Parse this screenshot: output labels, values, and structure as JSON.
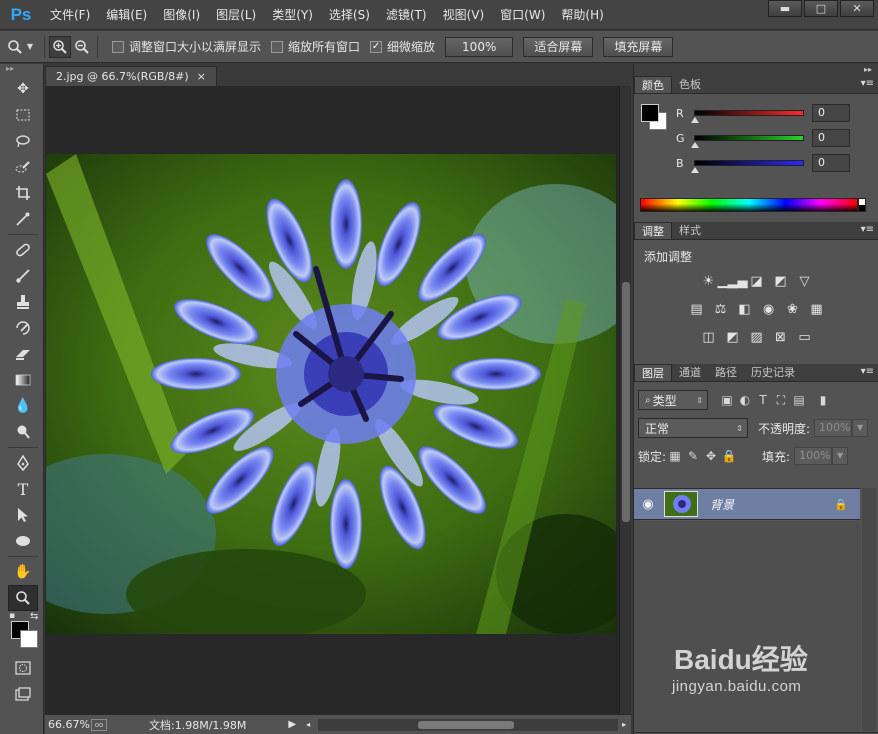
{
  "app": {
    "logo": "Ps"
  },
  "menu": [
    "文件(F)",
    "编辑(E)",
    "图像(I)",
    "图层(L)",
    "类型(Y)",
    "选择(S)",
    "滤镜(T)",
    "视图(V)",
    "窗口(W)",
    "帮助(H)"
  ],
  "window_controls": {
    "minimize": "▬",
    "maximize": "□",
    "close": "✕"
  },
  "options": {
    "resize_windows_label": "调整窗口大小以满屏显示",
    "resize_windows_checked": false,
    "zoom_all_windows_label": "缩放所有窗口",
    "zoom_all_windows_checked": false,
    "scrubby_zoom_label": "细微缩放",
    "scrubby_zoom_checked": true,
    "actual_pixels_label": "100%",
    "fit_screen_label": "适合屏幕",
    "fill_screen_label": "填充屏幕"
  },
  "document": {
    "tab_title": "2.jpg @ 66.7%(RGB/8#)",
    "tab_close": "×",
    "zoom": "66.67%",
    "doc_info": "文档:1.98M/1.98M"
  },
  "color_panel": {
    "tabs": [
      "颜色",
      "色板"
    ],
    "channels": [
      {
        "label": "R",
        "value": "0",
        "color": "#ff2a2a"
      },
      {
        "label": "G",
        "value": "0",
        "color": "#2ad42a"
      },
      {
        "label": "B",
        "value": "0",
        "color": "#2a2aff"
      }
    ],
    "foreground": "#000000",
    "background": "#ffffff"
  },
  "adjustments_panel": {
    "tabs": [
      "调整",
      "样式"
    ],
    "title": "添加调整"
  },
  "layers_panel": {
    "tabs": [
      "图层",
      "通道",
      "路径",
      "历史记录"
    ],
    "filter_kind": "类型",
    "blend_mode": "正常",
    "opacity_label": "不透明度:",
    "opacity_value": "100%",
    "lock_label": "锁定:",
    "fill_label": "填充:",
    "fill_value": "100%",
    "layers": [
      {
        "name": "背景",
        "visible": true,
        "locked": true
      }
    ]
  },
  "watermark": {
    "logo": "Baidu经验",
    "url": "jingyan.baidu.com"
  }
}
